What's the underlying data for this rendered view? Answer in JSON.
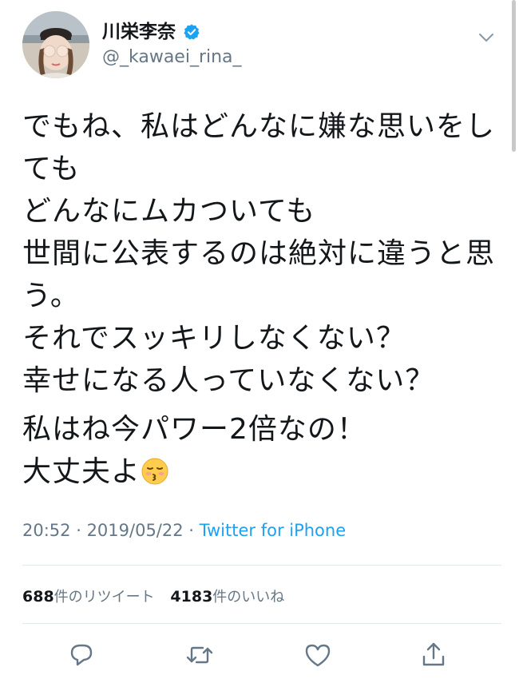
{
  "author": {
    "display_name": "川栄李奈",
    "handle": "@_kawaei_rina_",
    "verified": true
  },
  "tweet": {
    "lines": [
      "でもね、私はどんなに嫌な思いをし",
      "ても",
      "どんなにムカついても",
      "世間に公表するのは絶対に違うと思",
      "う。",
      "それでスッキリしなくない？",
      "幸せになる人っていなくない？"
    ],
    "lines2": [
      "私はね今パワー2倍なの！",
      "大丈夫よ"
    ],
    "emoji": "kissing-face-with-closed-eyes"
  },
  "meta": {
    "time": "20:52",
    "separator": " · ",
    "date": "2019/05/22",
    "source": "Twitter for iPhone"
  },
  "stats": {
    "retweets_count": "688",
    "retweets_label": "件のリツイート",
    "likes_count": "4183",
    "likes_label": "件のいいね"
  },
  "actions": [
    "reply-icon",
    "retweet-icon",
    "like-icon",
    "share-icon"
  ],
  "colors": {
    "accent": "#1da1f2",
    "text": "#14171a",
    "secondary": "#657786",
    "divider": "#e1e8ed"
  }
}
